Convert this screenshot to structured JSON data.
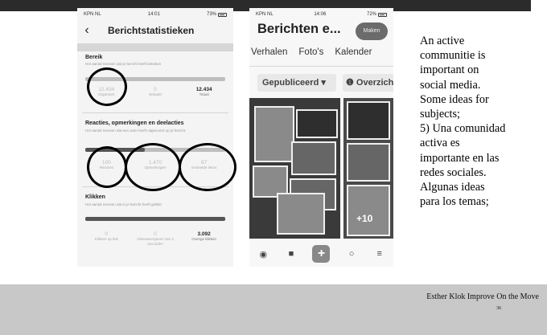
{
  "phone1": {
    "status": {
      "carrier": "KPN NL",
      "time": "14:01",
      "battery": "73%"
    },
    "back_icon": "chevron-left-icon",
    "title": "Berichtstatistieken",
    "bereik": {
      "title": "Bereik",
      "subtitle": "Het aantal mensen dat je bericht heeft bekeken",
      "stats": [
        {
          "value": "12.434",
          "label": "Organisch"
        },
        {
          "value": "0",
          "label": "Betaald"
        },
        {
          "value": "12.434",
          "label": "Totaal"
        }
      ]
    },
    "reacties": {
      "title": "Reacties, opmerkingen en deelacties",
      "subtitle": "Het aantal mensen dat een actie heeft uitgevoerd op je bericht.",
      "stats": [
        {
          "value": "100",
          "label": "Reacties"
        },
        {
          "value": "1.470",
          "label": "Opmerkingen"
        },
        {
          "value": "87",
          "label": "Gedeelde items"
        }
      ]
    },
    "klikken": {
      "title": "Klikken",
      "subtitle": "Het aantal mensen dat in je bericht heeft geklikt",
      "stats": [
        {
          "value": "0",
          "label": "Klikken op link"
        },
        {
          "value": "0",
          "label": "Videoweergaven van 3 seconden"
        },
        {
          "value": "3.092",
          "label": "Overige klikken"
        }
      ]
    }
  },
  "phone2": {
    "status": {
      "carrier": "KPN NL",
      "time": "14:06",
      "battery": "72%"
    },
    "title": "Berichten e...",
    "maken_label": "Maken",
    "tabs": [
      "Verhalen",
      "Foto's",
      "Kalender"
    ],
    "filter_label": "Gepubliceerd ▾",
    "overzicht_label": "Overzicht",
    "more_photos": "+10",
    "nav_icons": [
      "home-icon",
      "pages-icon",
      "add-icon",
      "chat-icon",
      "menu-icon"
    ]
  },
  "slide_text": "An active\ncommunitie is\nimportant on\nsocial media.\nSome ideas for\nsubjects;\n5) Una comunidad\nactiva es\nimportante en las\nredes sociales.\nAlgunas ideas\npara los temas;",
  "footer": {
    "author_title": "Esther Klok   Improve On the Move",
    "page_number": "36"
  },
  "colors": {
    "footer_bg": "#c8c8c8",
    "top_bar": "#2b2b2b",
    "circle": "#000000"
  }
}
